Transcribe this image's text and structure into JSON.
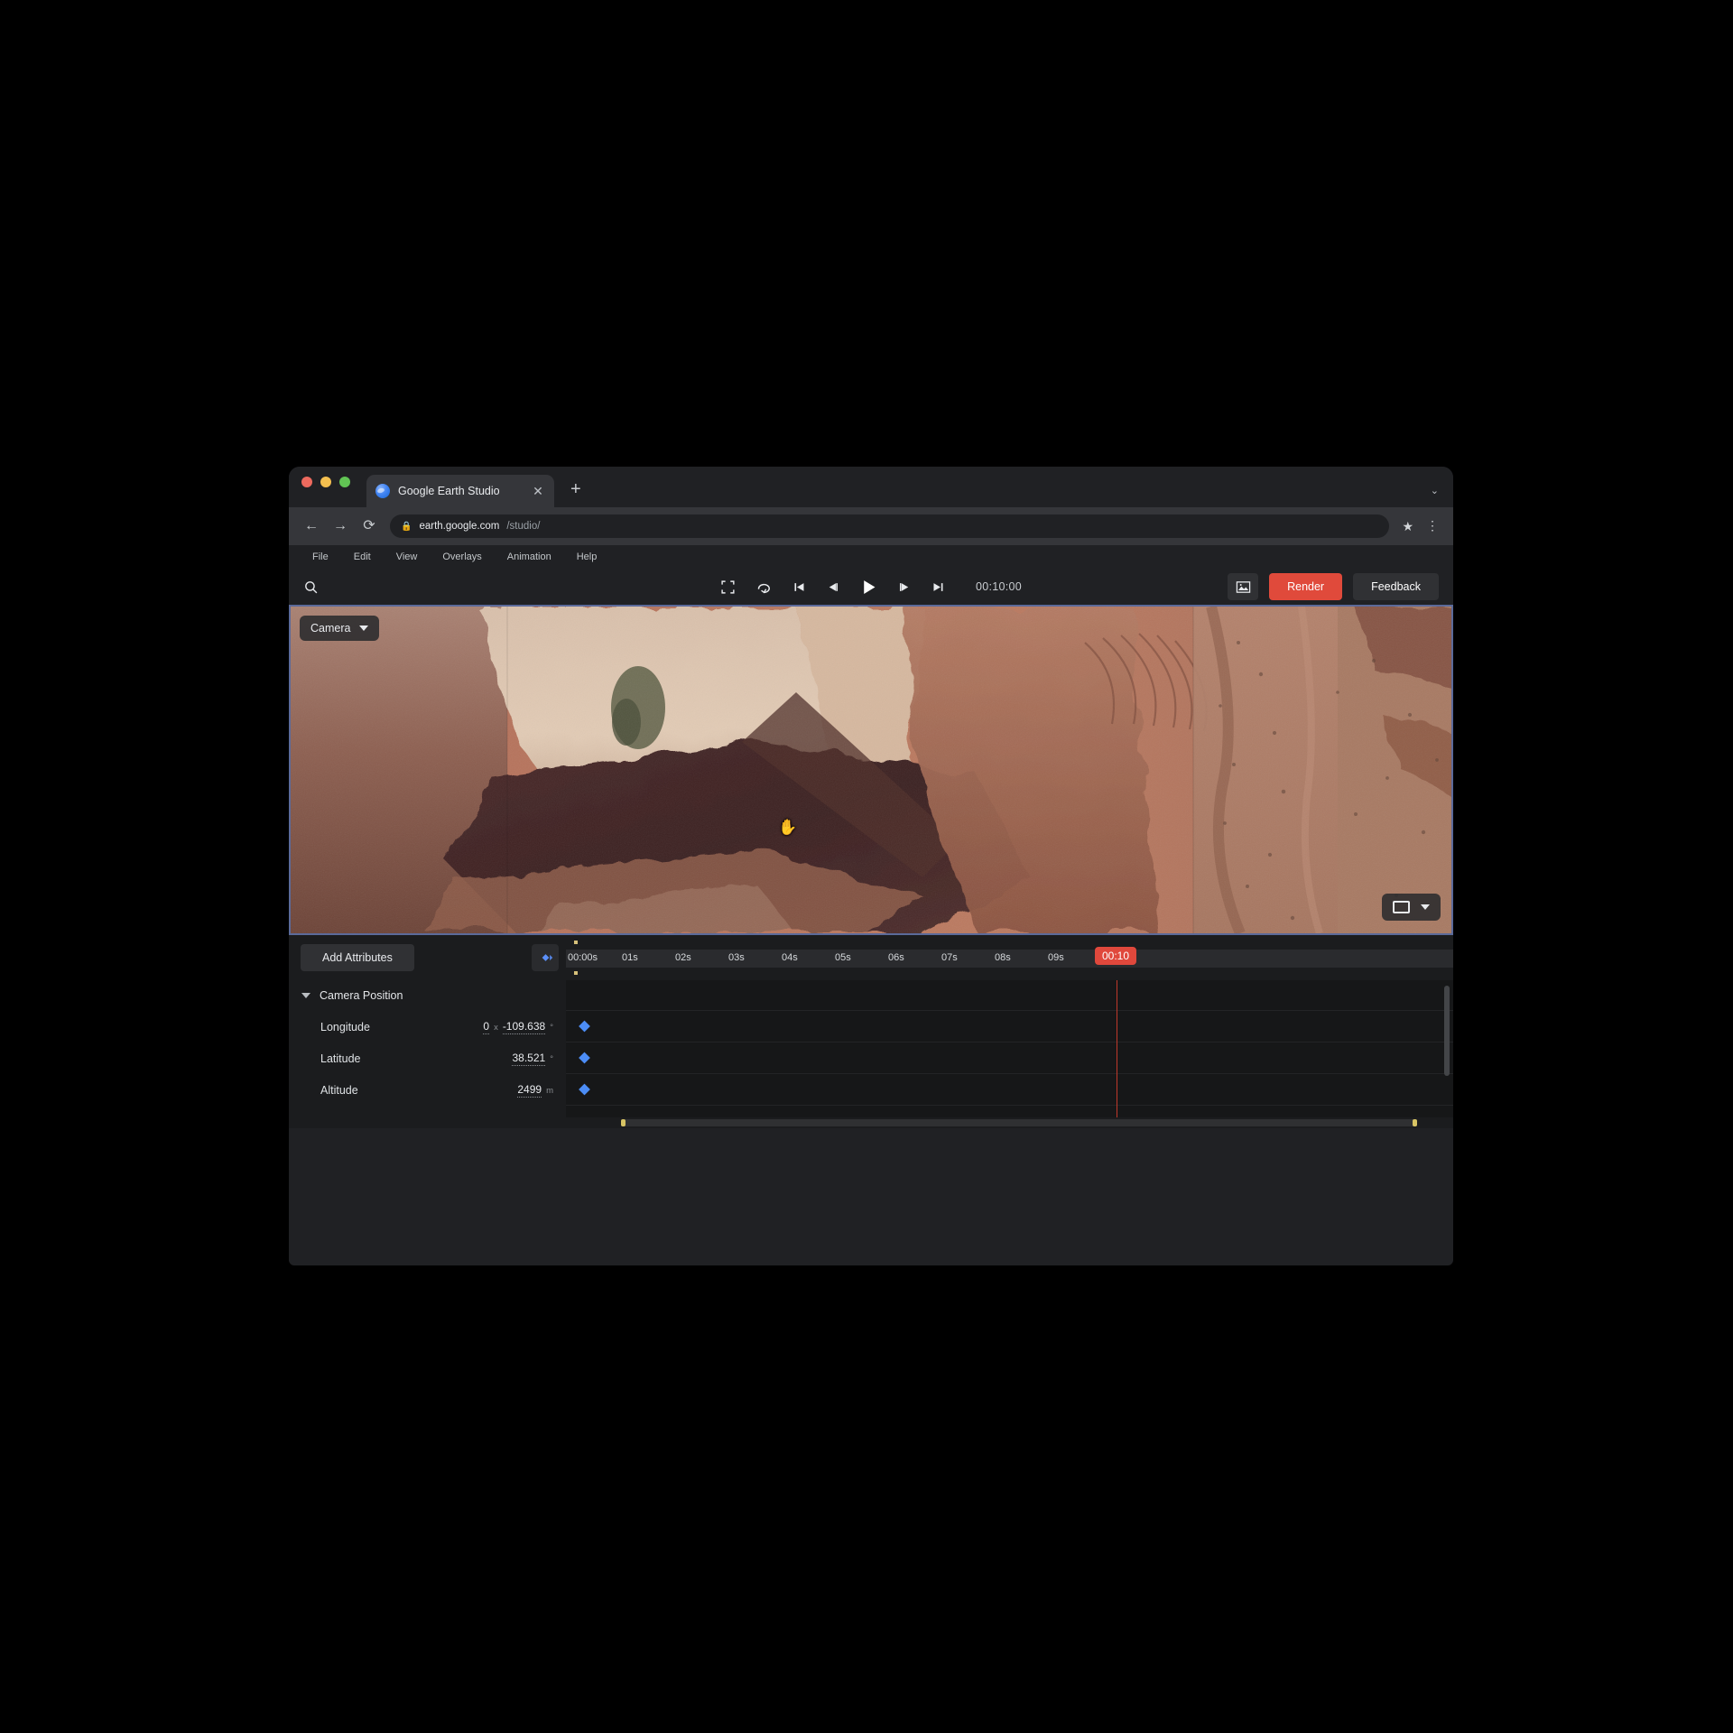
{
  "browser": {
    "traffic_lights": [
      "close",
      "minimize",
      "zoom"
    ],
    "tab": {
      "title": "Google Earth Studio",
      "favicon": "earth-globe-icon",
      "close": "✕"
    },
    "new_tab_label": "+",
    "tab_list_caret": "⌄",
    "nav": {
      "back": "←",
      "forward": "→",
      "reload": "⟳"
    },
    "url": {
      "lock": "🔒",
      "host": "earth.google.com",
      "path": "/studio/"
    },
    "bookmark_star": "★",
    "menu_kebab": "⋮"
  },
  "menubar": {
    "items": [
      {
        "label": "File"
      },
      {
        "label": "Edit"
      },
      {
        "label": "View"
      },
      {
        "label": "Overlays"
      },
      {
        "label": "Animation"
      },
      {
        "label": "Help"
      }
    ]
  },
  "toolbar": {
    "search_icon": "search-icon",
    "transport": {
      "fit_label": "fit-to-view",
      "loop_label": "loop",
      "jump_start_label": "jump-to-start",
      "prev_frame_label": "previous-frame",
      "play_label": "play",
      "next_frame_label": "next-frame",
      "jump_end_label": "jump-to-end"
    },
    "timecode": "00:10:00",
    "snapshot_icon": "image-icon",
    "render_label": "Render",
    "feedback_label": "Feedback",
    "render_color": "#e04a3b"
  },
  "viewport": {
    "camera_pill": {
      "label": "Camera",
      "caret": "▾"
    },
    "aspect_pill": {
      "icon": "rectangle-icon",
      "caret": "▾"
    },
    "cursor": "grabbing-hand",
    "border_color": "#5b6a9a"
  },
  "editor": {
    "add_attributes_label": "Add Attributes",
    "keyframe_toggle_icon": "keyframe-diamond-icon",
    "ruler": {
      "ticks": [
        "00:00s",
        "01s",
        "02s",
        "03s",
        "04s",
        "05s",
        "06s",
        "07s",
        "08s",
        "09s"
      ],
      "playhead_label": "00:10",
      "playhead_color": "#e0483c"
    },
    "group": {
      "label": "Camera Position",
      "expanded": true,
      "attributes": [
        {
          "name": "Longitude",
          "revolutions": "0",
          "rev_unit": "x",
          "value": "-109.638",
          "unit": "°"
        },
        {
          "name": "Latitude",
          "value": "38.521",
          "unit": "°"
        },
        {
          "name": "Altitude",
          "value": "2499",
          "unit": "m"
        }
      ]
    },
    "keyframe_color": "#4c8df6",
    "selected_keyframe_color": "#d8c464"
  }
}
